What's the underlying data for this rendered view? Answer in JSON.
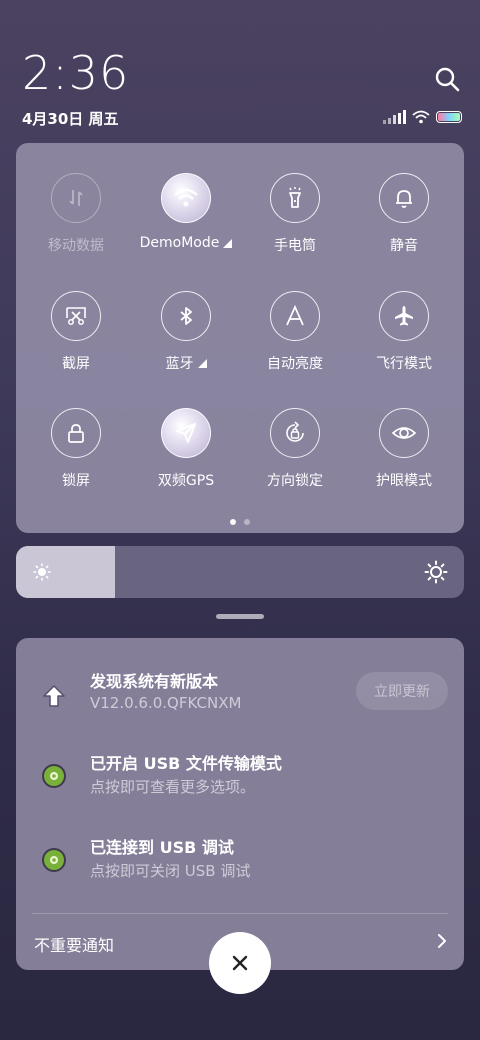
{
  "status_bar": {
    "time": "2:36",
    "date": "4月30日 周五",
    "icons": [
      "search-icon",
      "signal-icon",
      "wifi-icon",
      "battery-icon"
    ]
  },
  "quick_settings": {
    "tiles": [
      {
        "label": "移动数据",
        "icon": "mobile-data-icon",
        "state": "disabled"
      },
      {
        "label": "DemoMode",
        "icon": "wifi-icon",
        "state": "active",
        "expandable": true
      },
      {
        "label": "手电筒",
        "icon": "flashlight-icon",
        "state": "off"
      },
      {
        "label": "静音",
        "icon": "bell-icon",
        "state": "off"
      },
      {
        "label": "截屏",
        "icon": "screenshot-icon",
        "state": "off"
      },
      {
        "label": "蓝牙",
        "icon": "bluetooth-icon",
        "state": "off",
        "expandable": true
      },
      {
        "label": "自动亮度",
        "icon": "auto-brightness-icon",
        "state": "off"
      },
      {
        "label": "飞行模式",
        "icon": "airplane-icon",
        "state": "off"
      },
      {
        "label": "锁屏",
        "icon": "lock-icon",
        "state": "off"
      },
      {
        "label": "双频GPS",
        "icon": "gps-icon",
        "state": "active"
      },
      {
        "label": "方向锁定",
        "icon": "rotation-lock-icon",
        "state": "off"
      },
      {
        "label": "护眼模式",
        "icon": "eye-icon",
        "state": "off"
      }
    ],
    "page_count": 2,
    "current_page": 1
  },
  "brightness": {
    "level": 0.22
  },
  "notifications": [
    {
      "title": "发现系统有新版本",
      "subtitle": "V12.0.6.0.QFKCNXM",
      "icon": "update-arrow-icon",
      "action": "立即更新"
    },
    {
      "title": "已开启 USB 文件传输模式",
      "subtitle": "点按即可查看更多选项。",
      "icon": "android-settings-icon"
    },
    {
      "title": "已连接到 USB 调试",
      "subtitle": "点按即可关闭 USB 调试",
      "icon": "android-settings-icon"
    }
  ],
  "minor_notifications_label": "不重要通知",
  "colors": {
    "panel": "#948ea8",
    "accent": "#ffffff",
    "gear_green": "#7ab03a"
  }
}
